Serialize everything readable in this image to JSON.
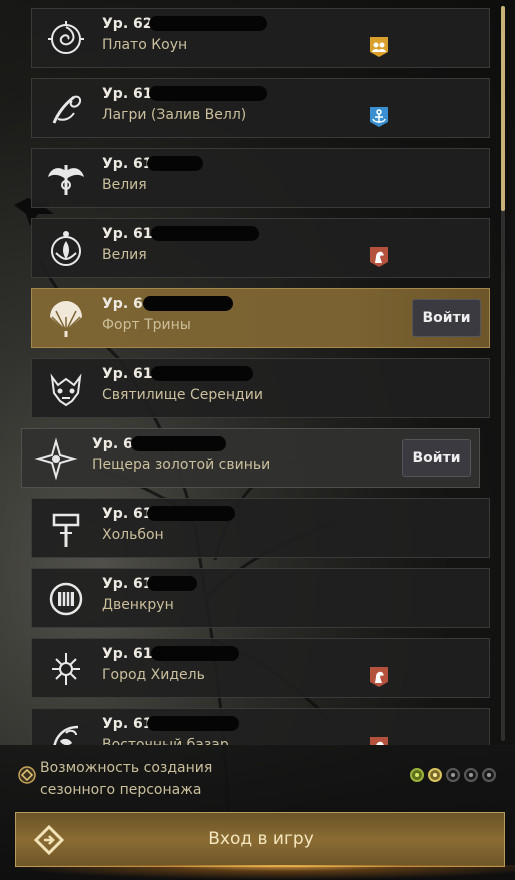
{
  "characters": [
    {
      "level_label": "Ур. 62",
      "location": "Плато Коун",
      "emblem_icon": "spiral-flower-icon",
      "badge_icon": "party-badge-icon",
      "badge_color": "#d9a12b",
      "state": "normal"
    },
    {
      "level_label": "Ур. 61",
      "location": "Лагри (Залив Велл)",
      "emblem_icon": "serpent-scythe-icon",
      "badge_icon": "anchor-badge-icon",
      "badge_color": "#3a8fd0",
      "state": "normal"
    },
    {
      "level_label": "Ур. 61",
      "location": "Велия",
      "emblem_icon": "winged-crest-icon",
      "badge_icon": "",
      "badge_color": "",
      "state": "normal"
    },
    {
      "level_label": "Ур. 61",
      "location": "Велия",
      "emblem_icon": "lotus-orb-icon",
      "badge_icon": "horse-badge-icon",
      "badge_color": "#b5523e",
      "state": "normal"
    },
    {
      "level_label": "Ур. 64",
      "location": "Форт Трины",
      "emblem_icon": "fan-icon",
      "badge_icon": "",
      "badge_color": "",
      "state": "selected",
      "button_label": "Войти"
    },
    {
      "level_label": "Ур. 61",
      "location": "Святилище Серендии",
      "emblem_icon": "dragon-mask-icon",
      "badge_icon": "",
      "badge_color": "",
      "state": "normal"
    },
    {
      "level_label": "Ур. 61",
      "location": "Пещера золотой свиньи",
      "emblem_icon": "shuriken-icon",
      "badge_icon": "",
      "badge_color": "",
      "state": "hovered",
      "button_label": "Войти"
    },
    {
      "level_label": "Ур. 61",
      "location": "Хольбон",
      "emblem_icon": "hammer-icon",
      "badge_icon": "",
      "badge_color": "",
      "state": "normal"
    },
    {
      "level_label": "Ур. 61",
      "location": "Двенкрун",
      "emblem_icon": "round-shield-icon",
      "badge_icon": "",
      "badge_color": "",
      "state": "normal"
    },
    {
      "level_label": "Ур. 61",
      "location": "Город Хидель",
      "emblem_icon": "star-sigil-icon",
      "badge_icon": "horse-badge-icon",
      "badge_color": "#b5523e",
      "state": "normal"
    },
    {
      "level_label": "Ур. 61",
      "location": "Восточный базар",
      "emblem_icon": "vine-crest-icon",
      "badge_icon": "horse-badge-icon",
      "badge_color": "#b5523e",
      "state": "normal"
    }
  ],
  "season": {
    "text_line1": "Возможность создания",
    "text_line2": "сезонного персонажа",
    "steps_done": 1,
    "steps_active": 1,
    "steps_total": 5
  },
  "play_button": {
    "label": "Вход в игру"
  },
  "colors": {
    "accent_gold": "#c9b27a",
    "selected_card": "#7d6433",
    "location_text": "#cbbf9c"
  }
}
